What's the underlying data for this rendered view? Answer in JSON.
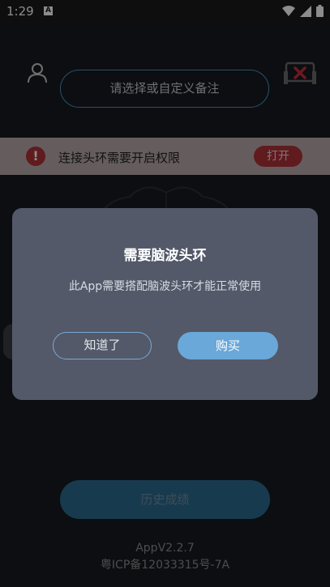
{
  "status_bar": {
    "time": "1:29",
    "notification_icon": "A",
    "icons": [
      "wifi-icon",
      "signal-icon",
      "battery-icon"
    ]
  },
  "header": {
    "user_icon": "user-icon",
    "device_icon": "headband-disconnected-icon",
    "remark_placeholder": "请选择或自定义备注"
  },
  "permission_banner": {
    "icon": "warning-icon",
    "text": "连接头环需要开启权限",
    "button": "打开",
    "accent": "#b0323a"
  },
  "history_button": "历史成绩",
  "footer": {
    "version": "AppV2.2.7",
    "icp": "粤ICP备12033315号-7A"
  },
  "dialog": {
    "title": "需要脑波头环",
    "message": "此App需要搭配脑波头环才能正常使用",
    "dismiss_label": "知道了",
    "buy_label": "购买"
  }
}
